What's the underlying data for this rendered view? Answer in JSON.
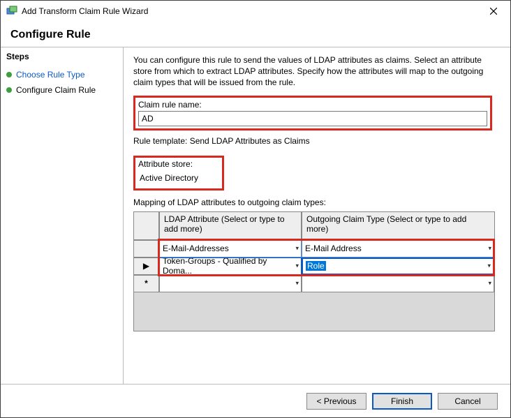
{
  "window": {
    "title": "Add Transform Claim Rule Wizard"
  },
  "header": "Configure Rule",
  "sidebar": {
    "label": "Steps",
    "steps": [
      {
        "label": "Choose Rule Type",
        "link": true
      },
      {
        "label": "Configure Claim Rule",
        "link": false
      }
    ]
  },
  "main": {
    "instruction": "You can configure this rule to send the values of LDAP attributes as claims. Select an attribute store from which to extract LDAP attributes. Specify how the attributes will map to the outgoing claim types that will be issued from the rule.",
    "ruleNameLabel": "Claim rule name:",
    "ruleNameValue": "AD",
    "ruleTemplate": "Rule template: Send LDAP Attributes as Claims",
    "attrStoreLabel": "Attribute store:",
    "attrStoreValue": "Active Directory",
    "mappingLabel": "Mapping of LDAP attributes to outgoing claim types:",
    "grid": {
      "headers": {
        "col1": "LDAP Attribute (Select or type to add more)",
        "col2": "Outgoing Claim Type (Select or type to add more)"
      },
      "rows": [
        {
          "marker": "",
          "attr": "E-Mail-Addresses",
          "claim": "E-Mail Address",
          "selected": false
        },
        {
          "marker": "▶",
          "attr": "Token-Groups - Qualified by Doma...",
          "claim": "Role",
          "selected": true
        },
        {
          "marker": "*",
          "attr": "",
          "claim": "",
          "selected": false
        }
      ]
    }
  },
  "footer": {
    "previous": "< Previous",
    "finish": "Finish",
    "cancel": "Cancel"
  },
  "highlightColor": "#d9291f"
}
